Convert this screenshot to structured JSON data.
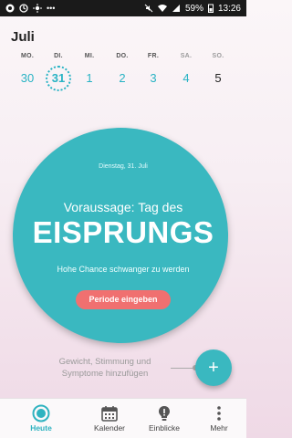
{
  "status_bar": {
    "battery": "59%",
    "time": "13:26",
    "icons_left": [
      "chrome-icon",
      "update-icon",
      "brightness-icon",
      "more-dots-icon"
    ],
    "icons_right": [
      "mute-icon",
      "wifi-icon",
      "signal-icon",
      "battery-icon"
    ]
  },
  "header": {
    "month": "Juli"
  },
  "week": {
    "days": [
      {
        "name": "MO.",
        "num": "30"
      },
      {
        "name": "DI.",
        "num": "31"
      },
      {
        "name": "MI.",
        "num": "1"
      },
      {
        "name": "DO.",
        "num": "2"
      },
      {
        "name": "FR.",
        "num": "3"
      },
      {
        "name": "SA.",
        "num": "4"
      },
      {
        "name": "SO.",
        "num": "5"
      }
    ]
  },
  "circle": {
    "date": "Dienstag, 31. Juli",
    "prediction": "Voraussage: Tag des",
    "headline": "EISPRUNGS",
    "chance": "Hohe Chance schwanger zu werden",
    "period_button": "Periode eingeben"
  },
  "add_hint": {
    "line1": "Gewicht, Stimmung und",
    "line2": "Symptome hinzufügen"
  },
  "nav": {
    "items": [
      {
        "label": "Heute",
        "icon": "today-icon"
      },
      {
        "label": "Kalender",
        "icon": "calendar-icon"
      },
      {
        "label": "Einblicke",
        "icon": "insights-bulb-icon"
      },
      {
        "label": "Mehr",
        "icon": "more-vertical-icon"
      }
    ]
  },
  "colors": {
    "accent": "#3ab8c0",
    "period_button": "#f07070"
  }
}
